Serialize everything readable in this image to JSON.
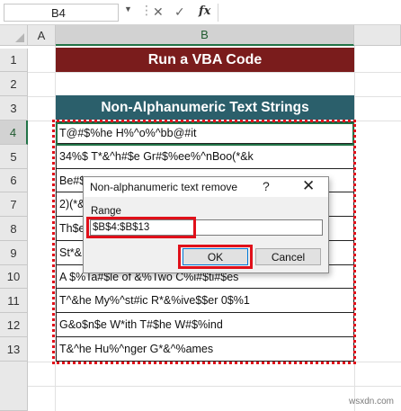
{
  "formula_bar": {
    "name_box": "B4",
    "dots": "⋮",
    "cancel_icon": "✕",
    "enter_icon": "✓",
    "fx_label": "fx",
    "formula": ""
  },
  "columns": [
    "A",
    "B"
  ],
  "rows": [
    "1",
    "2",
    "3",
    "4",
    "5",
    "6",
    "7",
    "8",
    "9",
    "10",
    "11",
    "12",
    "13"
  ],
  "cells": {
    "vba_title": "Run a VBA Code",
    "table_header": "Non-Alphanumeric Text Strings",
    "data": [
      "T@#$%he H%^o%^bb@#it",
      "34%$ T*&^h#$e Gr#$%ee%^nBoo(*&k",
      "Be#$",
      "2)(*&",
      "Th$e",
      "St*&",
      "A $%Ta#$le of &%Two C%i#$ti#$es",
      "T^&he My%^st#ic R*&%ive$$er 0$%1",
      "G&o$n$e W*ith T#$he W#$%ind",
      "T&^he Hu%^nger G*&^%ames"
    ]
  },
  "dialog": {
    "title": "Non-alphanumeric text remove",
    "help": "?",
    "close": "✕",
    "range_label": "Range",
    "range_value": "$B$4:$B$13",
    "ok_label": "OK",
    "cancel_label": "Cancel"
  },
  "watermark": "wsxdn.com",
  "colors": {
    "vba_title_bg": "#7a1c1c",
    "table_header_bg": "#2b5f6b",
    "selection_red": "#e0101a",
    "excel_green": "#217346"
  }
}
